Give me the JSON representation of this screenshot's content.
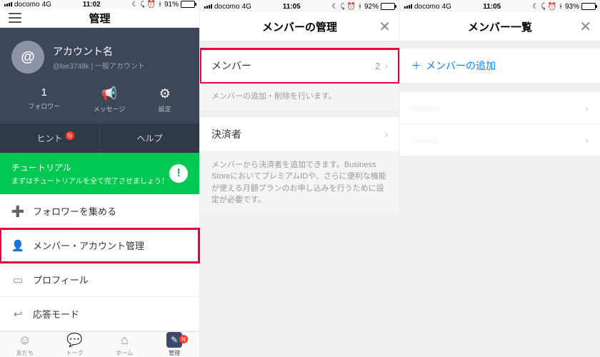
{
  "screen1": {
    "status": {
      "carrier": "docomo",
      "network": "4G",
      "time": "11:02",
      "battery_pct": "91%",
      "battery_fill": 91
    },
    "nav": {
      "title": "管理"
    },
    "profile": {
      "name": "アカウント名",
      "id": "@bie3748k",
      "type": "一般アカウント"
    },
    "stats": {
      "followers_count": "1",
      "followers_label": "フォロワー",
      "message_label": "メッセージ",
      "settings_label": "設定"
    },
    "buttons": {
      "hint": "ヒント",
      "help": "ヘルプ",
      "badge": "N"
    },
    "tutorial": {
      "title": "チュートリアル",
      "sub": "まずはチュートリアルを全て完了させましょう！"
    },
    "menu": {
      "followers": "フォロワーを集める",
      "members": "メンバー・アカウント管理",
      "profile": "プロフィール",
      "response": "応答モード"
    },
    "tabs": {
      "friends": "友だち",
      "talk": "トーク",
      "home": "ホーム",
      "manage": "管理",
      "badge": "N"
    }
  },
  "screen2": {
    "status": {
      "carrier": "docomo",
      "network": "4G",
      "time": "11:05",
      "battery_pct": "92%",
      "battery_fill": 92
    },
    "nav": {
      "title": "メンバーの管理"
    },
    "rows": {
      "member_label": "メンバー",
      "member_count": "2",
      "member_note": "メンバーの追加・削除を行います。",
      "payer_label": "決済者",
      "payer_note": "メンバーから決済者を追加できます。Business StoreにおいてプレミアムIDや、さらに便利な機能が使える月額プランのお申し込みを行うために設定が必要です。"
    }
  },
  "screen3": {
    "status": {
      "carrier": "docomo",
      "network": "4G",
      "time": "11:05",
      "battery_pct": "93%",
      "battery_fill": 93
    },
    "nav": {
      "title": "メンバー一覧"
    },
    "add_member": "メンバーの追加",
    "members": [
      "———",
      "———"
    ]
  }
}
